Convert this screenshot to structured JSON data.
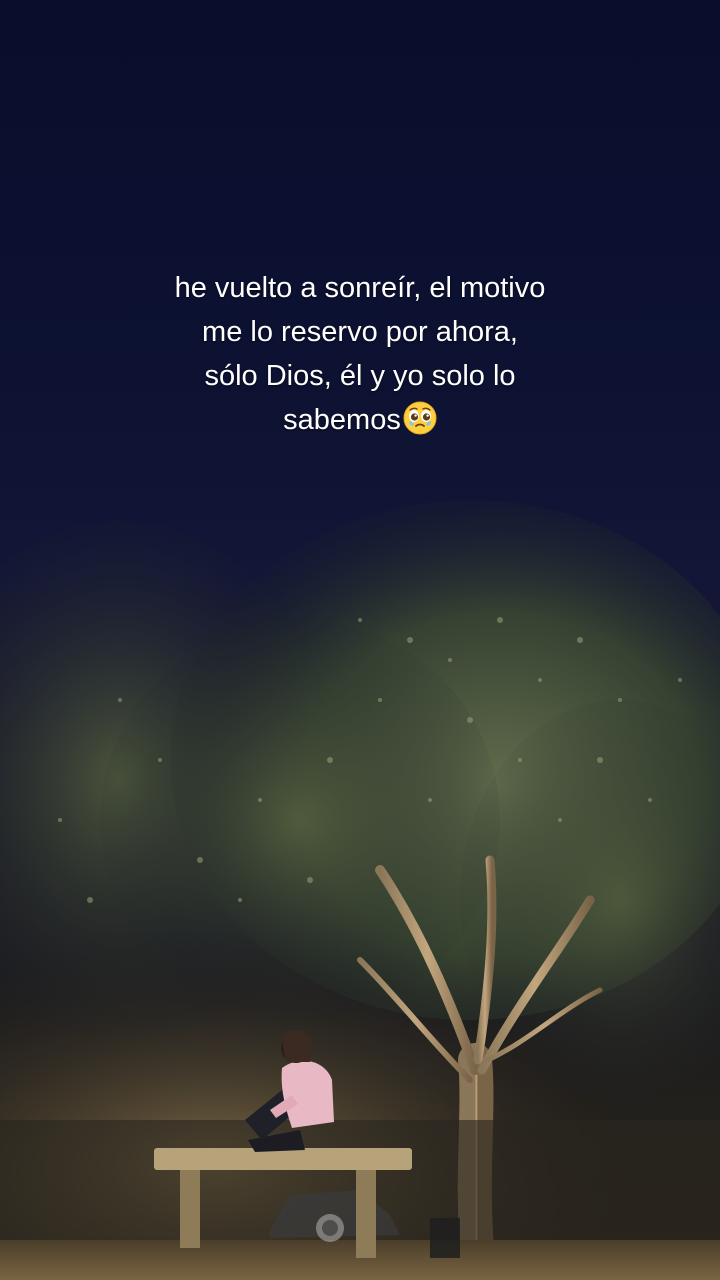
{
  "caption": {
    "line1": "he vuelto a sonreír, el motivo",
    "line2": "me lo reservo por ahora,",
    "line3": "sólo Dios, él y yo solo lo",
    "line4": "sabemos",
    "emoji": "pleading-face-with-tears"
  },
  "scene": {
    "description_colors": {
      "sky": "#0c1030",
      "foliage": "#3a4a2e",
      "ground": "#5a4a30",
      "bench": "#b7a37a",
      "shirt": "#e8b8c4"
    }
  }
}
